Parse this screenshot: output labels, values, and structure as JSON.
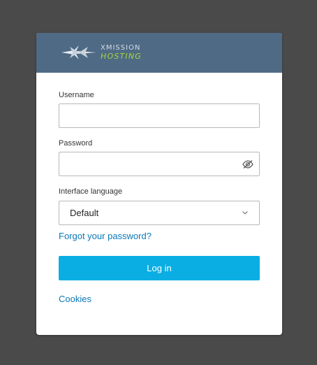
{
  "brand": {
    "line1": "XMISSION",
    "line2": "HOSTING",
    "logo_icon": "xmission-x-icon"
  },
  "form": {
    "username_label": "Username",
    "username_value": "",
    "password_label": "Password",
    "password_value": "",
    "password_toggle_icon": "eye-slash-icon",
    "language_label": "Interface language",
    "language_value": "Default",
    "language_dropdown_icon": "chevron-down-icon",
    "forgot_link": "Forgot your password?",
    "login_button": "Log in",
    "cookies_link": "Cookies"
  },
  "colors": {
    "background": "#4a4a4a",
    "header": "#4f6a85",
    "primary_button": "#0aaee3",
    "link": "#0a78b8",
    "brand_green": "#a5d63a"
  }
}
